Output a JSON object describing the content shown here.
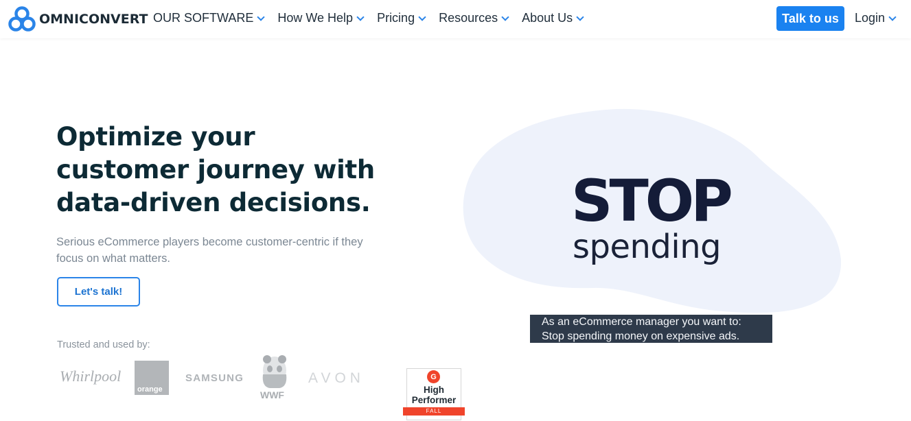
{
  "brand": {
    "name": "OMNICONVERT",
    "accent": "#1a82f0",
    "dark": "#0d2a35"
  },
  "nav": {
    "items": [
      {
        "label": "OUR SOFTWARE"
      },
      {
        "label": "How We Help"
      },
      {
        "label": "Pricing"
      },
      {
        "label": "Resources"
      },
      {
        "label": "About Us"
      }
    ],
    "talk_label": "Talk to us",
    "login_label": "Login"
  },
  "hero": {
    "headline": "Optimize your customer journey with data-driven decisions.",
    "subtext": "Serious eCommerce players become customer-centric if they focus on what matters.",
    "cta_label": "Let's talk!",
    "trusted_label": "Trusted and used by:"
  },
  "clients": {
    "whirlpool": "Whirlpool",
    "orange": "orange",
    "samsung": "SAMSUNG",
    "wwf": "WWF",
    "avon": "AVON"
  },
  "badge": {
    "logo": "G",
    "title_line1": "High",
    "title_line2": "Performer",
    "season": "FALL"
  },
  "video": {
    "stop_text": "STOP",
    "spending_text": "spending",
    "caption_line1": "As an eCommerce manager you want to:",
    "caption_line2": "Stop spending money on expensive ads."
  }
}
